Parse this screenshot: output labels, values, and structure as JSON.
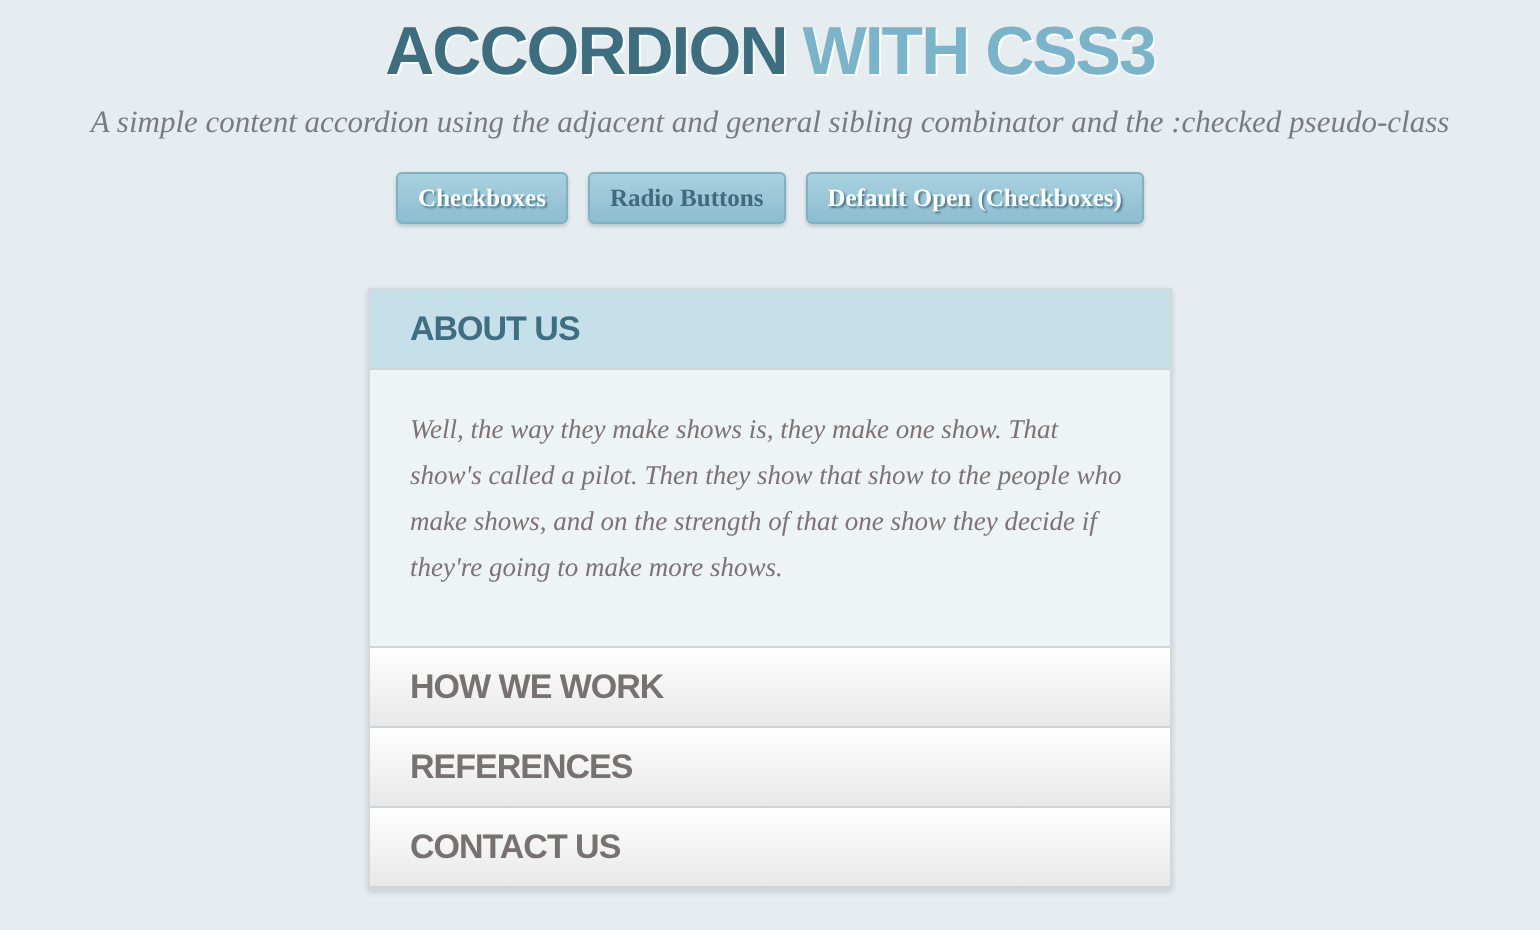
{
  "title": {
    "main": "ACCORDION",
    "accent": "WITH CSS3"
  },
  "subtitle": "A simple content accordion using the adjacent and general sibling combinator and the :checked pseudo-class",
  "demo_buttons": [
    {
      "label": "Checkboxes",
      "selected": false
    },
    {
      "label": "Radio Buttons",
      "selected": true
    },
    {
      "label": "Default Open (Checkboxes)",
      "selected": false
    }
  ],
  "sections": [
    {
      "label": "ABOUT US",
      "expanded": true,
      "content": "Well, the way they make shows is, they make one show. That show's called a pilot. Then they show that show to the people who make shows, and on the strength of that one show they decide if they're going to make more shows."
    },
    {
      "label": "HOW WE WORK",
      "expanded": false
    },
    {
      "label": "REFERENCES",
      "expanded": false
    },
    {
      "label": "CONTACT US",
      "expanded": false
    }
  ]
}
